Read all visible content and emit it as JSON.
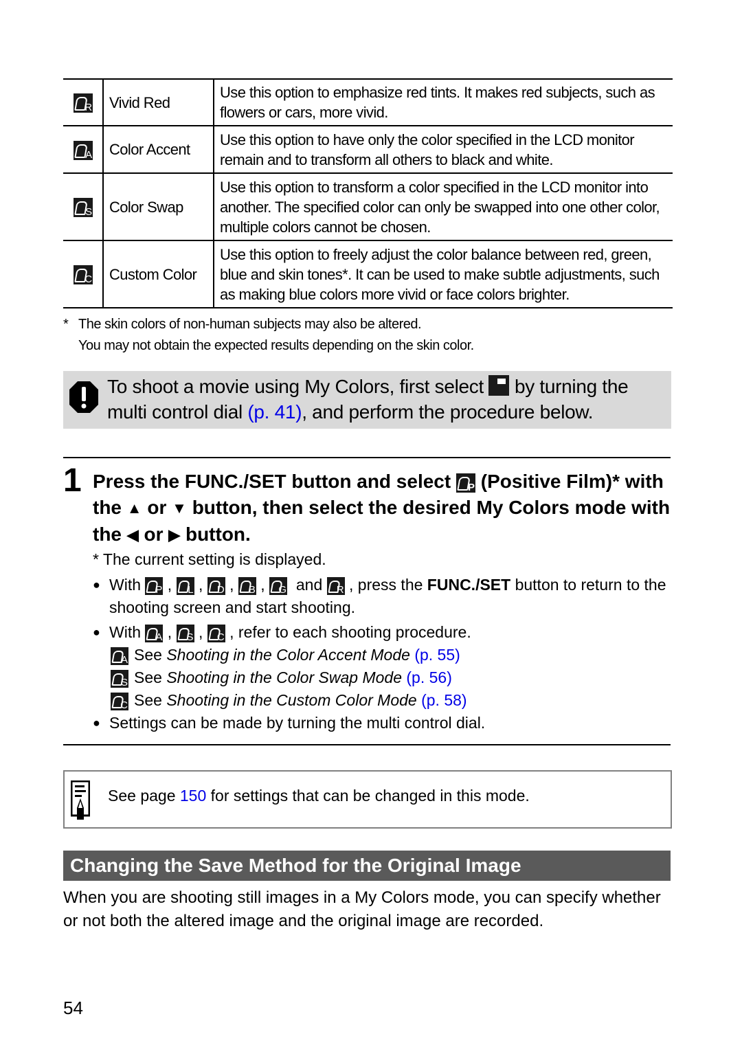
{
  "mode_table": {
    "rows": [
      {
        "icon": "vivid-red-icon",
        "letter": "R",
        "name": "Vivid Red",
        "description": "Use this option to emphasize red tints. It makes red subjects, such as flowers or cars, more vivid."
      },
      {
        "icon": "color-accent-icon",
        "letter": "A",
        "name": "Color Accent",
        "description": "Use this option to have only the color specified in the LCD monitor remain and to transform all others to black and white."
      },
      {
        "icon": "color-swap-icon",
        "letter": "S",
        "name": "Color Swap",
        "description": "Use this option to transform a color specified in the LCD monitor into another. The specified color can only be swapped into one other color, multiple colors cannot be chosen."
      },
      {
        "icon": "custom-color-icon",
        "letter": "C",
        "name": "Custom Color",
        "description": "Use this option to freely adjust the color balance between red, green, blue and skin tones*. It can be used to make subtle adjustments, such as making blue colors more vivid or face colors brighter."
      }
    ]
  },
  "table_footnote": {
    "marker": "*",
    "line1": "The skin colors of non-human subjects may also be altered.",
    "line2": "You may not obtain the expected results depending on the skin color."
  },
  "caution": {
    "icon": "caution-icon",
    "text_before": "To shoot a movie using My Colors, first select",
    "text_middle": "by turning the multi control dial",
    "link": "(p. 41)",
    "text_after": ", and perform the procedure below."
  },
  "step": {
    "number": "1",
    "head_part1": "Press the FUNC./SET button and select",
    "head_part2": "(Positive Film)* with the",
    "or1": "or",
    "head_part3": "button, then select the desired My Colors mode with the",
    "or2": "or",
    "head_part4": "button.",
    "note": "* The current setting is displayed.",
    "bullet1": {
      "with": "With",
      "letters": [
        "P",
        "L",
        "D",
        "B",
        "G"
      ],
      "and": "and",
      "last_letter": "R",
      "text_before_bold": ", press the",
      "bold": "FUNC./SET",
      "text_after_bold": "button to return to the shooting screen and start shooting."
    },
    "bullet2": {
      "with": "With",
      "letters": [
        "A",
        "S",
        "C"
      ],
      "text": ", refer to each shooting procedure."
    },
    "refs": [
      {
        "letter": "A",
        "see": "See",
        "title": "Shooting in the Color Accent Mode",
        "link": "(p. 55)"
      },
      {
        "letter": "S",
        "see": "See",
        "title": "Shooting in the Color Swap Mode",
        "link": "(p. 56)"
      },
      {
        "letter": "C",
        "see": "See",
        "title": "Shooting in the Custom Color Mode",
        "link": "(p. 58)"
      }
    ],
    "bullet3": "Settings can be made by turning the multi control dial."
  },
  "note": {
    "icon": "memo-icon",
    "before": "See page",
    "link": "150",
    "after": "for settings that can be changed in this mode."
  },
  "section": {
    "title": "Changing the Save Method for the Original Image",
    "body": "When you are shooting still images in a My Colors mode, you can specify whether or not both the altered image and the original image are recorded."
  },
  "page_number": "54",
  "colors": {
    "link": "#0000e6",
    "section_bg": "#5a5a5a",
    "caution_bg": "#d9d9d9"
  }
}
